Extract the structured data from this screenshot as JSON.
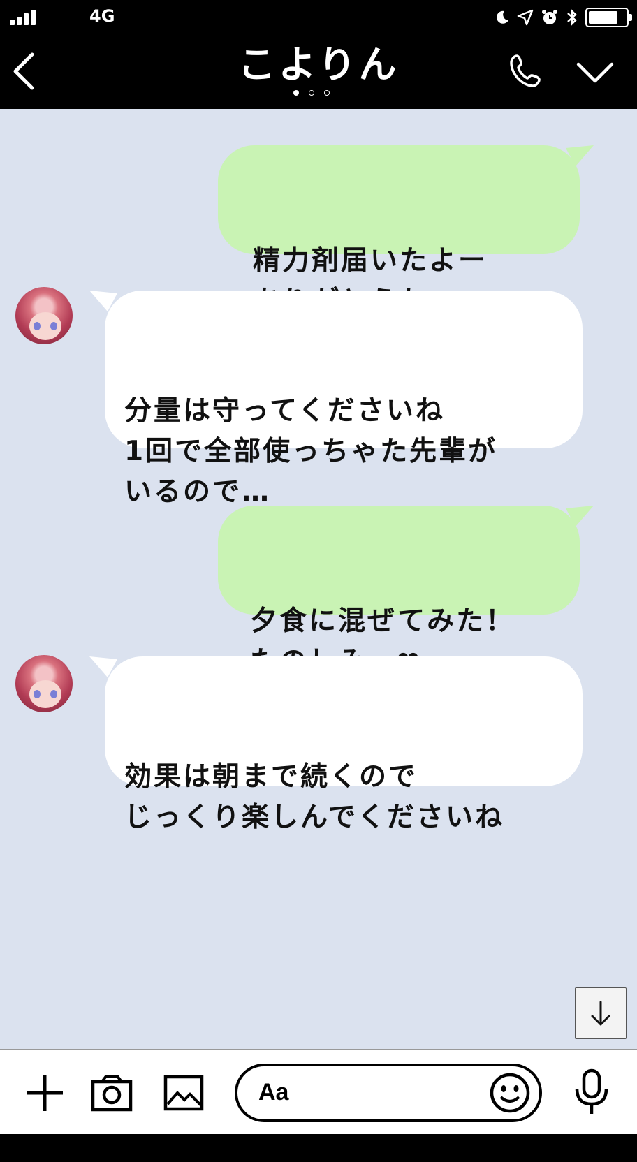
{
  "status_bar": {
    "network": "4G",
    "battery_level": 0.85
  },
  "header": {
    "title": "こよりん",
    "back_icon": "chevron-left-icon",
    "call_icon": "phone-icon",
    "menu_icon": "chevron-down-icon",
    "page_count": 3,
    "active_page": 1
  },
  "messages": [
    {
      "side": "sent",
      "text": "精力剤届いたよー\nありがとうね～"
    },
    {
      "side": "received",
      "text": "分量は守ってくださいね\n1回で全部使っちゃた先輩が\nいるので…"
    },
    {
      "side": "sent",
      "text": "夕食に混ぜてみた！\nたのしみ～❤"
    },
    {
      "side": "received",
      "text": "効果は朝まで続くので\nじっくり楽しんでくださいね"
    }
  ],
  "input_bar": {
    "placeholder": "Aa",
    "plus_icon": "plus-icon",
    "camera_icon": "camera-icon",
    "image_icon": "image-icon",
    "emoji_icon": "smiley-icon",
    "mic_icon": "microphone-icon"
  },
  "colors": {
    "chat_background": "#dbe2ef",
    "sent_bubble": "#c9f3b4",
    "received_bubble": "#ffffff",
    "header_background": "#000000"
  }
}
